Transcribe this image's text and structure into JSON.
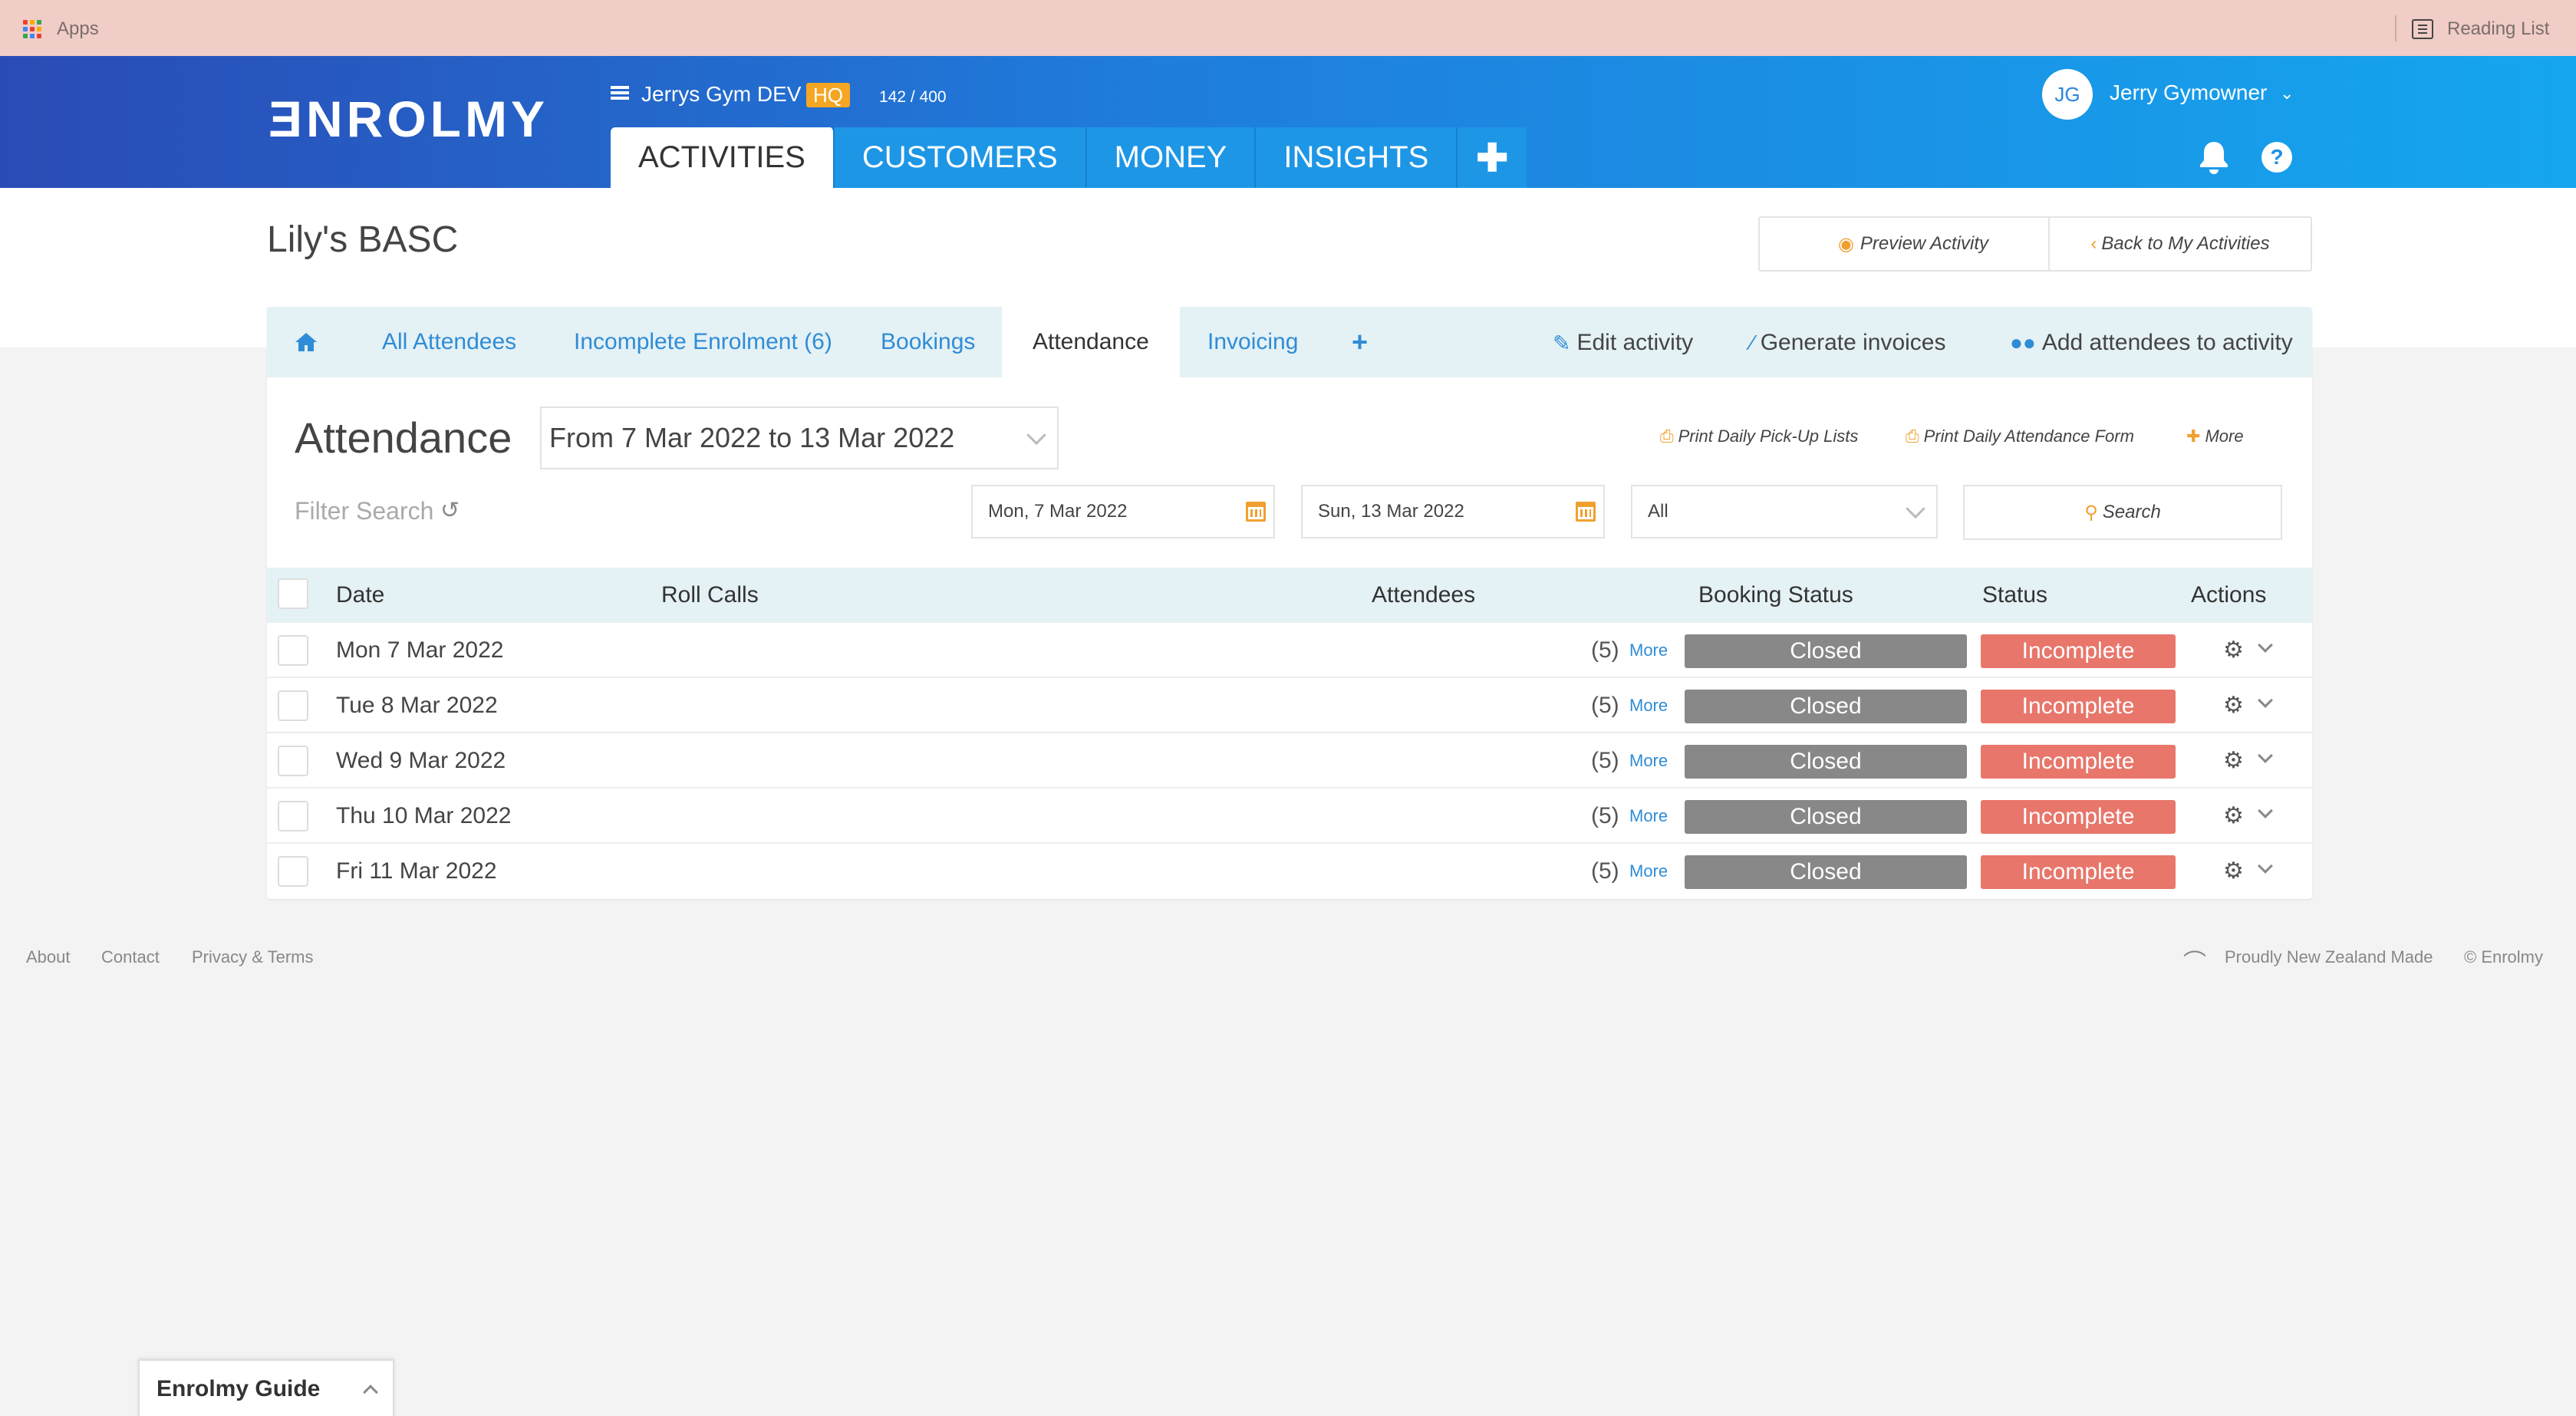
{
  "browser": {
    "apps_label": "Apps",
    "reading_list_label": "Reading List"
  },
  "header": {
    "logo": "ƎNROLMY",
    "org_name": "Jerrys Gym DEV",
    "hq_badge": "HQ",
    "count": "142 / 400",
    "user_initials": "JG",
    "user_name": "Jerry Gymowner",
    "nav_tabs": [
      {
        "label": "ACTIVITIES",
        "active": true
      },
      {
        "label": "CUSTOMERS"
      },
      {
        "label": "MONEY"
      },
      {
        "label": "INSIGHTS"
      }
    ],
    "add_tab_label": "✚",
    "help_label": "?"
  },
  "page": {
    "title": "Lily's BASC",
    "preview_label": "Preview Activity",
    "back_label": "Back to My Activities"
  },
  "subtabs": {
    "items": [
      "All Attendees",
      "Incomplete Enrolment (6)",
      "Bookings",
      "Attendance",
      "Invoicing"
    ],
    "active": "Attendance",
    "actions": [
      "Edit activity",
      "Generate invoices",
      "Add attendees to activity"
    ]
  },
  "attendance": {
    "title": "Attendance",
    "range": "From 7 Mar 2022 to 13 Mar 2022",
    "print_pickup": "Print Daily Pick-Up Lists",
    "print_attendance": "Print Daily Attendance Form",
    "more": "More",
    "filter_label": "Filter Search",
    "start_date": "Mon, 7 Mar 2022",
    "end_date": "Sun, 13 Mar 2022",
    "status_filter": "All",
    "search_label": "Search"
  },
  "table": {
    "columns": [
      "Date",
      "Roll Calls",
      "Attendees",
      "Booking Status",
      "Status",
      "Actions"
    ],
    "rows": [
      {
        "date": "Mon 7 Mar 2022",
        "count": "(5)",
        "more": "More",
        "booking": "Closed",
        "status": "Incomplete"
      },
      {
        "date": "Tue 8 Mar 2022",
        "count": "(5)",
        "more": "More",
        "booking": "Closed",
        "status": "Incomplete"
      },
      {
        "date": "Wed 9 Mar 2022",
        "count": "(5)",
        "more": "More",
        "booking": "Closed",
        "status": "Incomplete"
      },
      {
        "date": "Thu 10 Mar 2022",
        "count": "(5)",
        "more": "More",
        "booking": "Closed",
        "status": "Incomplete"
      },
      {
        "date": "Fri 11 Mar 2022",
        "count": "(5)",
        "more": "More",
        "booking": "Closed",
        "status": "Incomplete"
      }
    ]
  },
  "footer": {
    "links": [
      "About",
      "Contact",
      "Privacy & Terms"
    ],
    "nz_made": "Proudly New Zealand Made",
    "copyright": "© Enrolmy"
  },
  "guide": {
    "label": "Enrolmy Guide"
  },
  "colors": {
    "brand_blue": "#1f7ddc",
    "link_blue": "#2f8cd6",
    "accent_orange": "#f0a030",
    "closed_gray": "#888888",
    "incomplete_red": "#e8766b"
  }
}
